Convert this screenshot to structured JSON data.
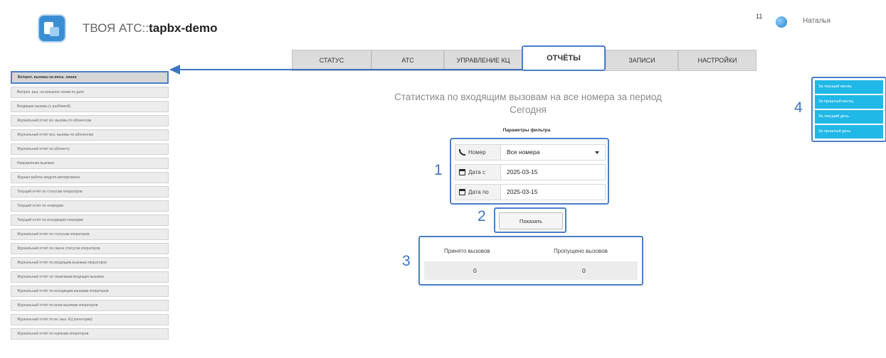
{
  "header": {
    "app_title_prefix": "ТВОЯ АТС::",
    "app_title_name": "tapbx-demo",
    "user_count": "11",
    "user_name": "Наталья"
  },
  "tabs": [
    {
      "label": "СТАТУС"
    },
    {
      "label": "АТС"
    },
    {
      "label": "УПРАВЛЕНИЕ КЦ"
    },
    {
      "label": "ОТЧЁТЫ"
    },
    {
      "label": "ЗАПИСИ"
    },
    {
      "label": "НАСТРОЙКИ"
    }
  ],
  "sidebar": {
    "items": [
      {
        "label": "Вх/проп. вызовы на внеш. линии"
      },
      {
        "label": "Вх/проп. выз. на внешние линии по дате"
      },
      {
        "label": "Входящие вызовы (с разбивкой)"
      },
      {
        "label": "Журнальный отчёт вх. вызовы по абонентам"
      },
      {
        "label": "Журнальный отчёт исх. вызовы по абонентам"
      },
      {
        "label": "Журнальный отчёт по абоненту"
      },
      {
        "label": "Направления вызовов"
      },
      {
        "label": "Журнал работы модуля автопрозвона"
      },
      {
        "label": "Текущий отчёт по статусам операторов"
      },
      {
        "label": "Текущий отчёт по очередям"
      },
      {
        "label": "Текущий отчёт по исходящим очередям"
      },
      {
        "label": "Журнальный отчёт по статусам операторов"
      },
      {
        "label": "Журнальный отчёт по смене статусов операторов"
      },
      {
        "label": "Журнальный отчёт по входящим вызовам операторов"
      },
      {
        "label": "Журнальный отчёт по тематикам входящих вызовов"
      },
      {
        "label": "Журнальный отчёт по исходящим вызовам операторов"
      },
      {
        "label": "Журнальный отчёт по всем вызовам операторов"
      },
      {
        "label": "Журнальный отчёт по вх. выз. КЦ (категории)"
      },
      {
        "label": "Журнальный отчёт по оценкам операторов"
      }
    ]
  },
  "report": {
    "title_line1": "Статистика по входящим вызовам на все номера за период",
    "title_line2": "Сегодня",
    "filter_caption": "Параметры фильтра",
    "number_label": "Номер",
    "number_value": "Все номера",
    "date_from_label": "Дата с",
    "date_from_value": "2025-03-15",
    "date_to_label": "Дата по",
    "date_to_value": "2025-03-15",
    "show_button": "Показать",
    "accepted_label": "Принято вызовов",
    "accepted_value": "0",
    "missed_label": "Пропущено вызовов",
    "missed_value": "0"
  },
  "quick_periods": [
    {
      "label": "За текущий месяц"
    },
    {
      "label": "За прошлый месяц"
    },
    {
      "label": "За текущий день"
    },
    {
      "label": "За прошлый день"
    }
  ],
  "annotations": {
    "n1": "1",
    "n2": "2",
    "n3": "3",
    "n4": "4"
  },
  "colors": {
    "accent": "#4a7fc8",
    "quick_period": "#20b8e6"
  }
}
